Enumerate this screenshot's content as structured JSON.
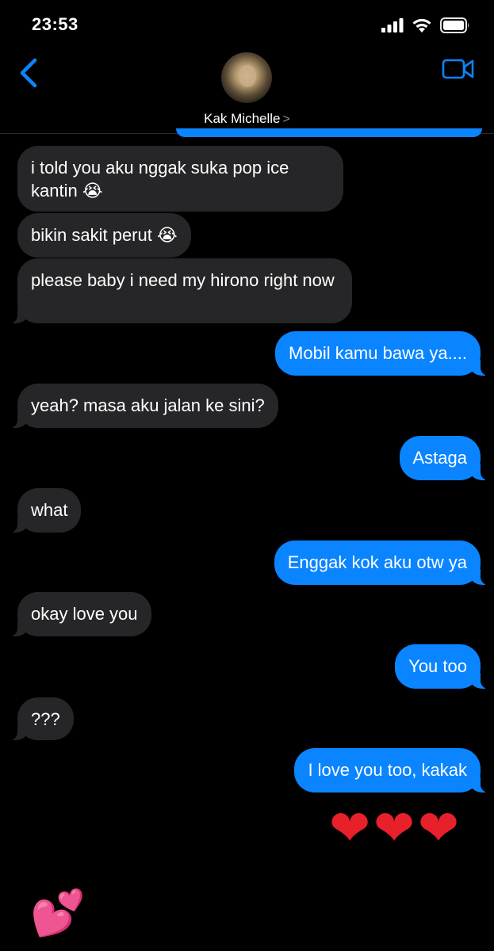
{
  "status_bar": {
    "time": "23:53"
  },
  "header": {
    "contact_name": "Kak Michelle",
    "chevron": ">",
    "back_icon": "chevron-left-icon",
    "video_icon": "video-camera-icon"
  },
  "colors": {
    "accent": "#0a84ff",
    "incoming_bubble": "#262628",
    "background": "#000000"
  },
  "messages": [
    {
      "dir": "in",
      "text": "i told you aku nggak suka pop ice kantin 😭"
    },
    {
      "dir": "in",
      "text": "bikin sakit perut 😭"
    },
    {
      "dir": "in",
      "text": "please baby i need my hirono right now"
    },
    {
      "dir": "out",
      "text": "Mobil kamu bawa ya...."
    },
    {
      "dir": "in",
      "text": "yeah? masa aku jalan ke sini?"
    },
    {
      "dir": "out",
      "text": "Astaga"
    },
    {
      "dir": "in",
      "text": "what"
    },
    {
      "dir": "out",
      "text": "Enggak kok aku otw ya"
    },
    {
      "dir": "in",
      "text": "okay love you"
    },
    {
      "dir": "out",
      "text": "You too"
    },
    {
      "dir": "in",
      "text": "???"
    },
    {
      "dir": "out",
      "text": "I love you too, kakak"
    },
    {
      "dir": "out",
      "text": "❤❤❤"
    },
    {
      "dir": "in",
      "text": "💕"
    }
  ]
}
